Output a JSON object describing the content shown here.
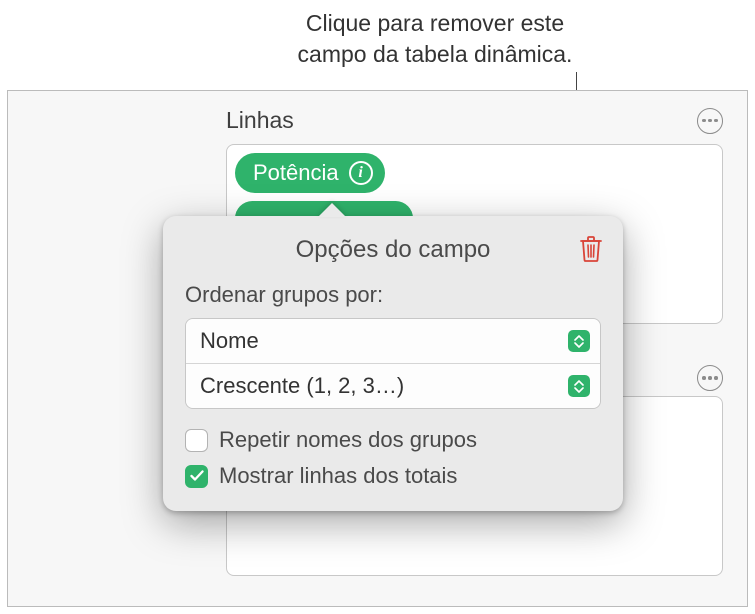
{
  "callout": {
    "line1": "Clique para remover este",
    "line2": "campo da tabela dinâmica."
  },
  "section": {
    "title": "Linhas"
  },
  "field": {
    "label": "Potência"
  },
  "popover": {
    "title": "Opções do campo",
    "sort_label": "Ordenar grupos por:",
    "sort_by": "Nome",
    "sort_order": "Crescente (1, 2, 3…)",
    "repeat_checkbox": {
      "label": "Repetir nomes dos grupos",
      "checked": false
    },
    "totals_checkbox": {
      "label": "Mostrar linhas dos totais",
      "checked": true
    }
  }
}
